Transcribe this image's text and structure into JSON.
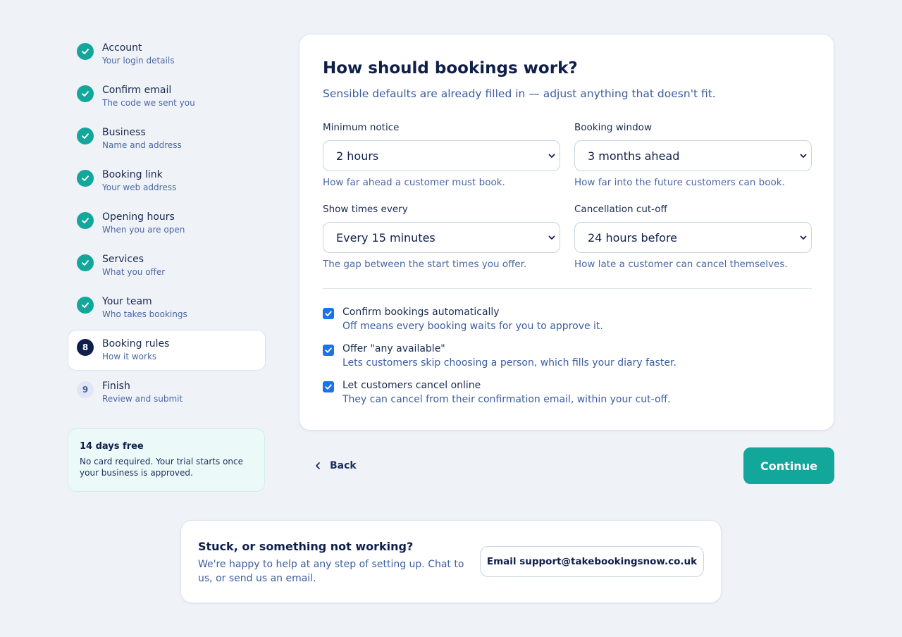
{
  "steps": [
    {
      "title": "Account",
      "subtitle": "Your login details",
      "state": "done"
    },
    {
      "title": "Confirm email",
      "subtitle": "The code we sent you",
      "state": "done"
    },
    {
      "title": "Business",
      "subtitle": "Name and address",
      "state": "done"
    },
    {
      "title": "Booking link",
      "subtitle": "Your web address",
      "state": "done"
    },
    {
      "title": "Opening hours",
      "subtitle": "When you are open",
      "state": "done"
    },
    {
      "title": "Services",
      "subtitle": "What you offer",
      "state": "done"
    },
    {
      "title": "Your team",
      "subtitle": "Who takes bookings",
      "state": "done"
    },
    {
      "title": "Booking rules",
      "subtitle": "How it works",
      "state": "active",
      "number": "8"
    },
    {
      "title": "Finish",
      "subtitle": "Review and submit",
      "state": "todo",
      "number": "9"
    }
  ],
  "trial": {
    "title": "14 days free",
    "text": "No card required. Your trial starts once your business is approved."
  },
  "card": {
    "title": "How should bookings work?",
    "subtitle": "Sensible defaults are already filled in — adjust anything that doesn't fit."
  },
  "fields": {
    "minimum_notice": {
      "label": "Minimum notice",
      "value": "2 hours",
      "help": "How far ahead a customer must book."
    },
    "booking_window": {
      "label": "Booking window",
      "value": "3 months ahead",
      "help": "How far into the future customers can book."
    },
    "show_times": {
      "label": "Show times every",
      "value": "Every 15 minutes",
      "help": "The gap between the start times you offer."
    },
    "cancellation": {
      "label": "Cancellation cut-off",
      "value": "24 hours before",
      "help": "How late a customer can cancel themselves."
    }
  },
  "checks": [
    {
      "label": "Confirm bookings automatically",
      "help": "Off means every booking waits for you to approve it.",
      "checked": true
    },
    {
      "label": "Offer \"any available\"",
      "help": "Lets customers skip choosing a person, which fills your diary faster.",
      "checked": true
    },
    {
      "label": "Let customers cancel online",
      "help": "They can cancel from their confirmation email, within your cut-off.",
      "checked": true
    }
  ],
  "nav": {
    "back_label": "Back",
    "continue_label": "Continue"
  },
  "help": {
    "title": "Stuck, or something not working?",
    "text": "We're happy to help at any step of setting up. Chat to us, or send us an email.",
    "email_button": "Email support@takebookingsnow.co.uk"
  },
  "colors": {
    "accent": "#13a69b",
    "navy": "#0f1f4a",
    "checkbox": "#1a73e8"
  }
}
